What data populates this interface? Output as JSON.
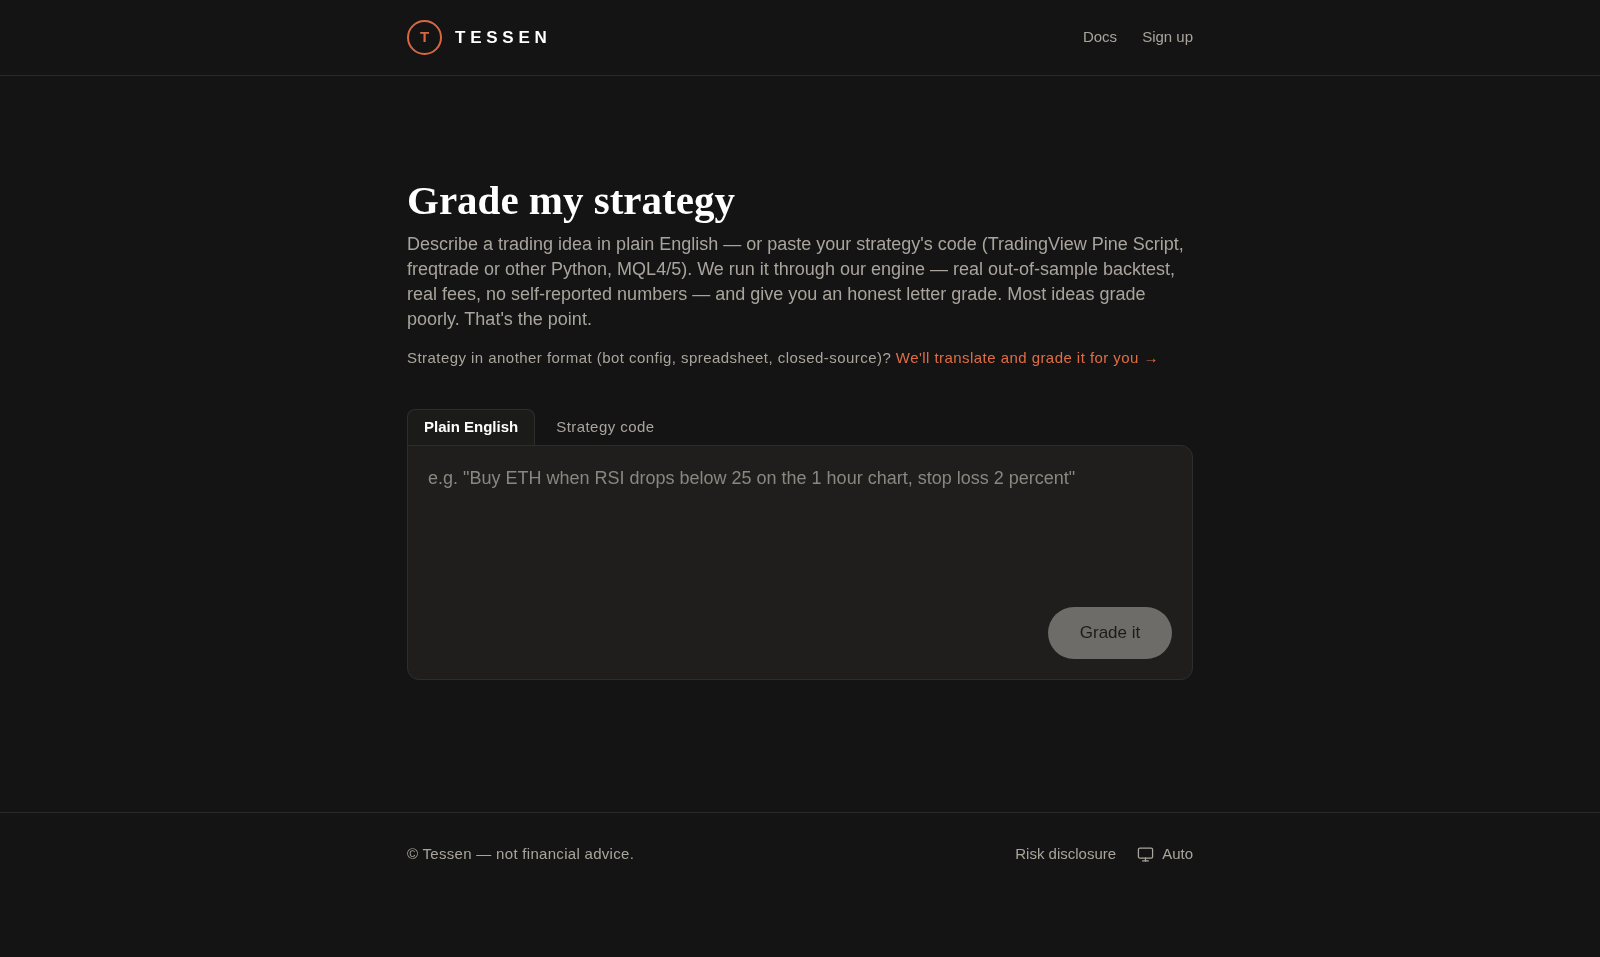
{
  "header": {
    "logo": {
      "letter": "T",
      "name": "TESSEN"
    },
    "nav": [
      "Docs",
      "Sign up"
    ]
  },
  "main": {
    "title": "Grade my strategy",
    "description": "Describe a trading idea in plain English — or paste your strategy's code (TradingView Pine Script, freqtrade or other Python, MQL4/5). We run it through our engine — real out-of-sample backtest, real fees, no self-reported numbers — and give you an honest letter grade. Most ideas grade poorly. That's the point.",
    "note": {
      "text": "Strategy in another format (bot config, spreadsheet, closed-source)?",
      "link": "We'll translate and grade it for you →"
    }
  },
  "tabs": [
    {
      "label": "Plain English",
      "selected": true
    },
    {
      "label": "Strategy code",
      "selected": false
    }
  ],
  "editor": {
    "placeholder": "e.g. \"Buy ETH when RSI drops below 25 on the 1 hour chart, stop loss 2 percent\"",
    "submit": {
      "label": "Grade it",
      "disabled": true
    }
  },
  "footer": {
    "copyright": "© Tessen — not financial advice.",
    "links": [
      "Risk disclosure"
    ],
    "theme": {
      "label": "Auto"
    }
  }
}
